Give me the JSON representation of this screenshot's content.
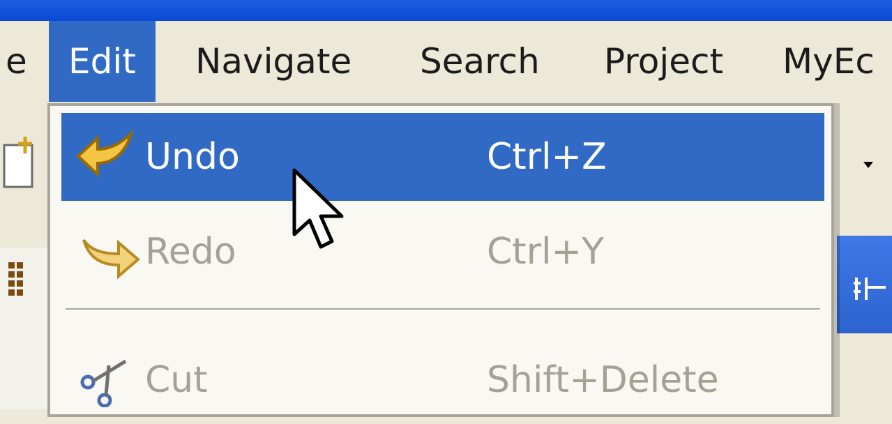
{
  "menubar": {
    "items": [
      {
        "label": "e"
      },
      {
        "label": "Edit"
      },
      {
        "label": "Navigate"
      },
      {
        "label": "Search"
      },
      {
        "label": "Project"
      },
      {
        "label": "MyEc"
      }
    ]
  },
  "edit_menu": {
    "items": [
      {
        "label": "Undo",
        "shortcut": "Ctrl+Z",
        "icon": "undo-arrow-icon",
        "state": "highlighted"
      },
      {
        "label": "Redo",
        "shortcut": "Ctrl+Y",
        "icon": "redo-arrow-icon",
        "state": "disabled"
      },
      {
        "label": "Cut",
        "shortcut": "Shift+Delete",
        "icon": "scissors-icon",
        "state": "disabled"
      }
    ]
  },
  "colors": {
    "titlebar": "#0a48d6",
    "menubar_bg": "#ece9d8",
    "highlight": "#316ac5",
    "disabled_text": "#a4a195"
  }
}
